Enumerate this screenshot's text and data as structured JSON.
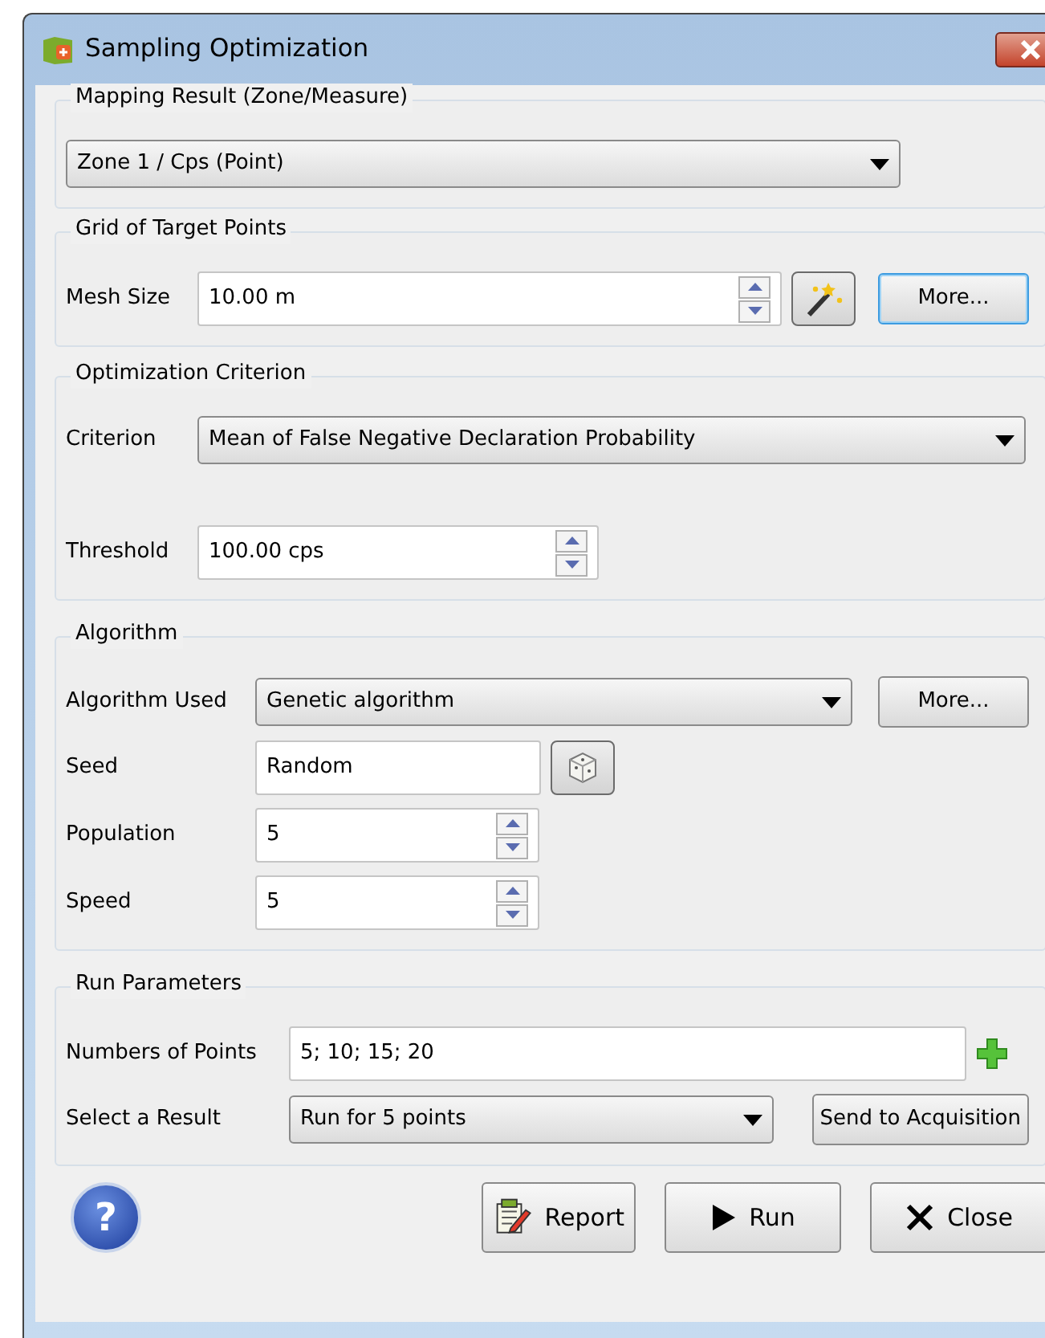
{
  "window": {
    "title": "Sampling Optimization"
  },
  "groups": [
    {
      "title": "Mapping Result (Zone/Measure)",
      "rows": [
        {
          "field": {
            "kind": "combo",
            "value": "Zone 1 / Cps (Point)"
          },
          "extras": []
        }
      ]
    },
    {
      "title": "Grid of Target Points",
      "rows": [
        {
          "label": "Mesh Size",
          "field": {
            "kind": "spin",
            "value": "10.00 m"
          },
          "extras": [
            {
              "kind": "wand"
            },
            {
              "kind": "button",
              "label": "More...",
              "focused": true
            }
          ]
        }
      ]
    },
    {
      "title": "Optimization Criterion",
      "rows": [
        {
          "label": "Criterion",
          "field": {
            "kind": "combo",
            "value": "Mean of False Negative Declaration Probability"
          },
          "extras": []
        },
        {
          "label": "Threshold",
          "field": {
            "kind": "spin",
            "value": "100.00 cps"
          },
          "extras": []
        }
      ]
    },
    {
      "title": "Algorithm",
      "rows": [
        {
          "label": "Algorithm Used",
          "field": {
            "kind": "combo",
            "value": "Genetic algorithm"
          },
          "extras": [
            {
              "kind": "button",
              "label": "More...",
              "focused": false
            }
          ]
        },
        {
          "label": "Seed",
          "field": {
            "kind": "text",
            "value": "Random"
          },
          "extras": [
            {
              "kind": "dice"
            }
          ]
        },
        {
          "label": "Population",
          "field": {
            "kind": "spin",
            "value": "5"
          },
          "extras": []
        },
        {
          "label": "Speed",
          "field": {
            "kind": "spin",
            "value": "5"
          },
          "extras": []
        }
      ]
    },
    {
      "title": "Run Parameters",
      "rows": [
        {
          "label": "Numbers of Points",
          "field": {
            "kind": "text",
            "value": "5; 10; 15; 20"
          },
          "extras": [
            {
              "kind": "plus"
            }
          ]
        },
        {
          "label": "Select a Result",
          "field": {
            "kind": "combo",
            "value": "Run for 5 points"
          },
          "extras": [
            {
              "kind": "button",
              "label": "Send to Acquisition",
              "focused": false
            }
          ]
        }
      ]
    }
  ],
  "help": "?",
  "buttons": [
    {
      "kind": "report",
      "label": "Report"
    },
    {
      "kind": "run",
      "label": "Run"
    },
    {
      "kind": "close",
      "label": "Close"
    }
  ]
}
